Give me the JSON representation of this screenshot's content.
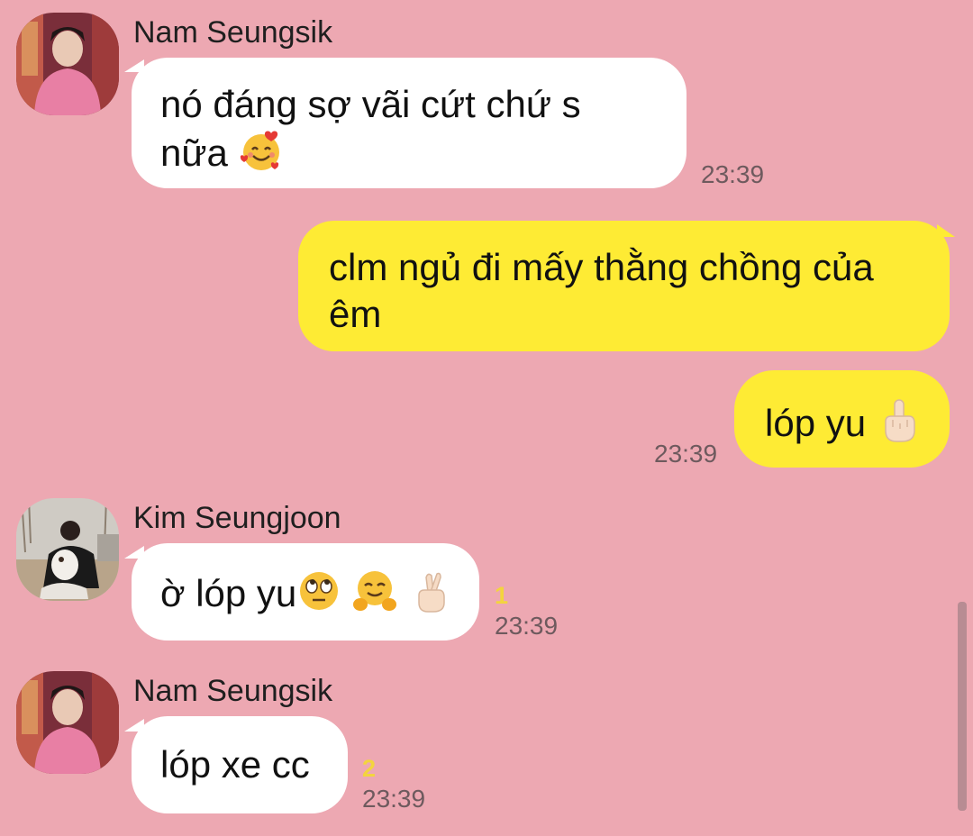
{
  "messages": [
    {
      "sender": "Nam Seungsik",
      "line1": "nó đáng sợ vãi cứt chứ s",
      "line2": "nữa",
      "emoji": "smiling-face-with-hearts-emoji",
      "time": "23:39"
    },
    {
      "sender": "",
      "line1": "clm ngủ đi mấy thằng chồng của",
      "line2": "êm"
    },
    {
      "sender": "",
      "text": "lóp yu",
      "emoji": "middle-finger-emoji",
      "time": "23:39"
    },
    {
      "sender": "Kim Seungjoon",
      "text": "ờ lóp yu",
      "emojis": [
        "eye-roll-emoji",
        "hugging-face-emoji",
        "crossed-fingers-emoji"
      ],
      "unread": "1",
      "time": "23:39"
    },
    {
      "sender": "Nam Seungsik",
      "text": "lóp xe cc",
      "unread": "2",
      "time": "23:39"
    }
  ],
  "colors": {
    "background": "#EDA8B2",
    "incoming_bubble": "#FFFFFF",
    "outgoing_bubble": "#FEEB34",
    "unread_count": "#F3D43E",
    "timestamp": "#6E5A5E"
  }
}
